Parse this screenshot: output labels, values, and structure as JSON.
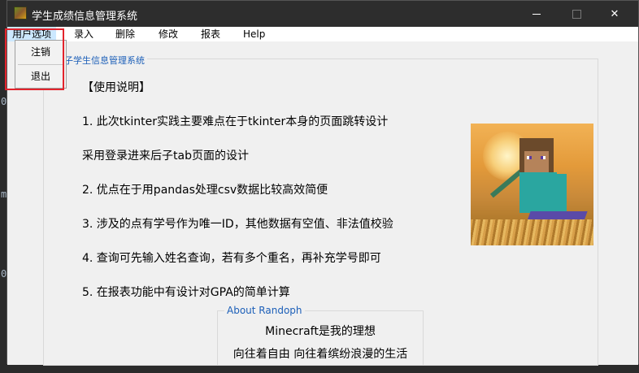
{
  "window": {
    "title": "学生成绩信息管理系统"
  },
  "menubar": {
    "items": [
      "用户选项",
      "录入",
      "删除",
      "修改",
      "报表",
      "Help"
    ]
  },
  "user_menu": {
    "items": [
      "注销",
      "退出"
    ]
  },
  "main_group": {
    "title": "子学生信息管理系统",
    "heading": "【使用说明】",
    "lines": [
      "1. 此次tkinter实践主要难点在于tkinter本身的页面跳转设计",
      "采用登录进来后子tab页面的设计",
      "2. 优点在于用pandas处理csv数据比较高效简便",
      "3. 涉及的点有学号作为唯一ID，其他数据有空值、非法值校验",
      "4. 查询可先输入姓名查询，若有多个重名，再补充学号即可",
      "5. 在报表功能中有设计对GPA的简单计算"
    ]
  },
  "about": {
    "title": "About Randoph",
    "line1": "Minecraft是我的理想",
    "line2": "向往着自由 向往着缤纷浪漫的生活"
  },
  "colors": {
    "titlebar": "#2d2d2d",
    "group_title": "#1c5fb8",
    "menu_active": "#cce8ff",
    "highlight": "#e3232c"
  }
}
